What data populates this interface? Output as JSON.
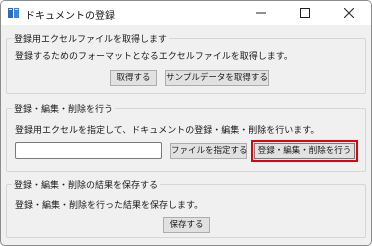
{
  "window": {
    "title": "ドキュメントの登録"
  },
  "icons": {
    "app": "book-icon",
    "minimize": "minimize-icon",
    "maximize": "maximize-icon",
    "close": "close-icon"
  },
  "sections": {
    "get_excel": {
      "legend": "登録用エクセルファイルを取得します",
      "description": "登録するためのフォーマットとなるエクセルファイルを取得します。",
      "get_button": "取得する",
      "sample_button": "サンプルデータを取得する"
    },
    "register": {
      "legend": "登録・編集・削除を行う",
      "description": "登録用エクセルを指定して、ドキュメントの登録・編集・削除を行います。",
      "file_input_value": "",
      "select_file_button": "ファイルを指定する",
      "execute_button": "登録・編集・削除を行う"
    },
    "save_results": {
      "legend": "登録・編集・削除の結果を保存する",
      "description": "登録・編集・削除を行った結果を保存します。",
      "save_button": "保存する"
    }
  },
  "colors": {
    "highlight": "#e0000f",
    "window_bg": "#f0f0f0",
    "button_bg": "#e1e1e1"
  }
}
